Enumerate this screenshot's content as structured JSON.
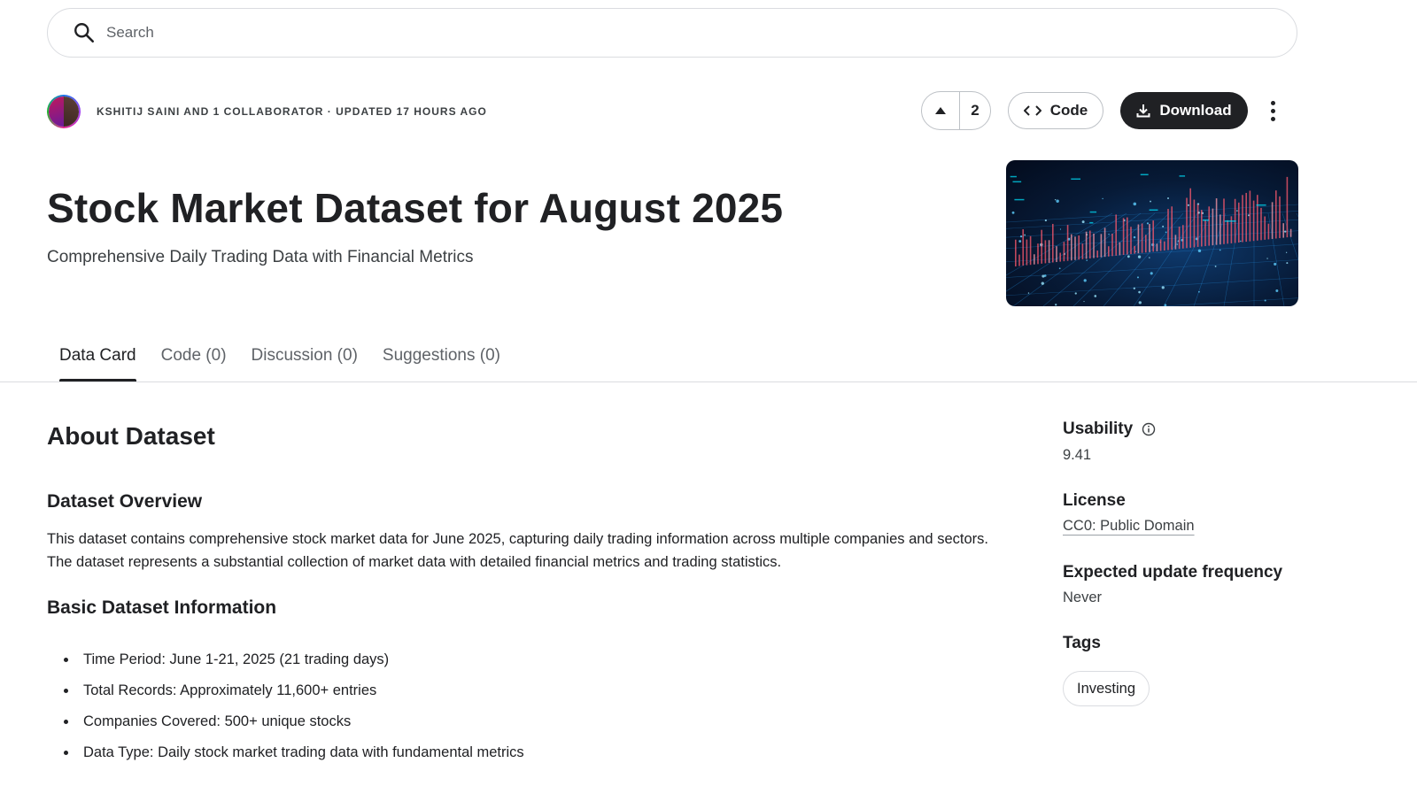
{
  "search": {
    "placeholder": "Search",
    "icon": "search-icon"
  },
  "meta": {
    "authors_text": "KSHITIJ SAINI AND 1 COLLABORATOR · UPDATED 17 HOURS AGO"
  },
  "actions": {
    "upvote_count": "2",
    "code_label": "Code",
    "download_label": "Download"
  },
  "header": {
    "title": "Stock Market Dataset for August 2025",
    "subtitle": "Comprehensive Daily Trading Data with Financial Metrics"
  },
  "tabs": [
    {
      "label": "Data Card",
      "active": true
    },
    {
      "label": "Code (0)",
      "active": false
    },
    {
      "label": "Discussion (0)",
      "active": false
    },
    {
      "label": "Suggestions (0)",
      "active": false
    }
  ],
  "main": {
    "about_title": "About Dataset",
    "overview_title": "Dataset Overview",
    "overview_text": "This dataset contains comprehensive stock market data for June 2025, capturing daily trading information across multiple companies and sectors. The dataset represents a substantial collection of market data with detailed financial metrics and trading statistics.",
    "basic_title": "Basic Dataset Information",
    "bullets": [
      "Time Period: June 1-21, 2025 (21 trading days)",
      "Total Records: Approximately 11,600+ entries",
      "Companies Covered: 500+ unique stocks",
      "Data Type: Daily stock market trading data with fundamental metrics"
    ]
  },
  "sidebar": {
    "usability_label": "Usability",
    "usability_value": "9.41",
    "license_label": "License",
    "license_value": "CC0: Public Domain",
    "frequency_label": "Expected update frequency",
    "frequency_value": "Never",
    "tags_label": "Tags",
    "tags": [
      "Investing"
    ]
  },
  "colors": {
    "primary_dark": "#202124",
    "border": "#dadce0",
    "muted_text": "#5f6368"
  }
}
